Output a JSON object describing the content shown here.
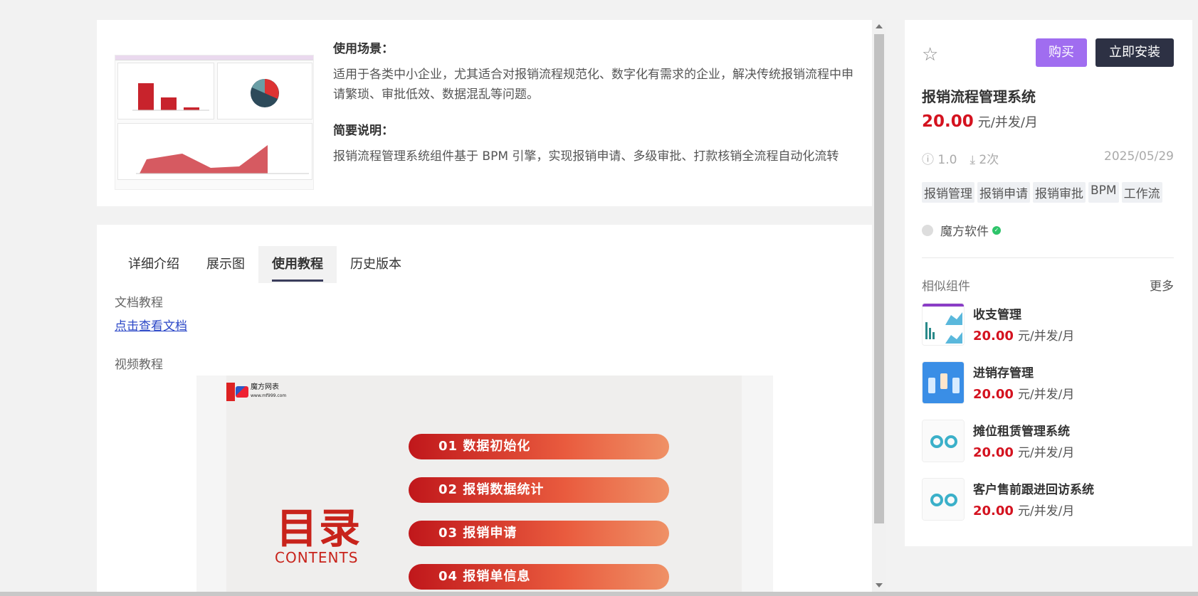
{
  "overview": {
    "scenario_title": "使用场景：",
    "scenario_text": "适用于各类中小企业，尤其适合对报销流程规范化、数字化有需求的企业，解决传统报销流程中申请繁琐、审批低效、数据混乱等问题。",
    "brief_title": "简要说明：",
    "brief_text": "报销流程管理系统组件基于 BPM 引擎，实现报销申请、多级审批、打款核销全流程自动化流转"
  },
  "tabs": [
    "详细介绍",
    "展示图",
    "使用教程",
    "历史版本"
  ],
  "active_tab": "使用教程",
  "tutorial": {
    "doc_label": "文档教程",
    "doc_link": "点击查看文档",
    "video_label": "视频教程"
  },
  "slide": {
    "logo_name": "魔方网表",
    "logo_url": "www.mf999.com",
    "title": "目录",
    "subtitle": "CONTENTS",
    "items": [
      "01  数据初始化",
      "02  报销数据统计",
      "03  报销申请",
      "04  报销单信息"
    ]
  },
  "product": {
    "buy_label": "购买",
    "install_label": "立即安装",
    "name": "报销流程管理系统",
    "price": "20.00",
    "unit": "元/并发/月",
    "version": "1.0",
    "downloads": "2次",
    "date": "2025/05/29",
    "tags": [
      "报销管理",
      "报销申请",
      "报销审批",
      "BPM",
      "工作流"
    ],
    "author": "魔方软件"
  },
  "similar": {
    "title": "相似组件",
    "more": "更多",
    "items": [
      {
        "name": "收支管理",
        "price": "20.00",
        "unit": "元/并发/月"
      },
      {
        "name": "进销存管理",
        "price": "20.00",
        "unit": "元/并发/月"
      },
      {
        "name": "摊位租赁管理系统",
        "price": "20.00",
        "unit": "元/并发/月"
      },
      {
        "name": "客户售前跟进回访系统",
        "price": "20.00",
        "unit": "元/并发/月"
      }
    ]
  },
  "colors": {
    "accent_price": "#d4121f",
    "buy": "#a06df0",
    "install": "#2d3144",
    "link": "#2b47c7"
  }
}
